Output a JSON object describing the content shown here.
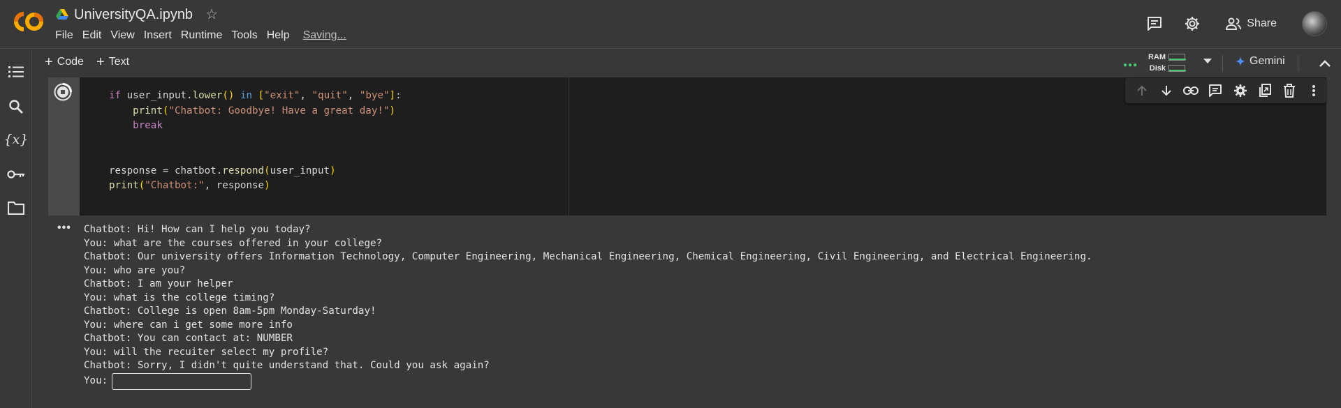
{
  "header": {
    "title": "UniversityQA.ipynb",
    "menu": [
      "File",
      "Edit",
      "View",
      "Insert",
      "Runtime",
      "Tools",
      "Help"
    ],
    "save_status": "Saving...",
    "share_label": "Share",
    "brand_colors": {
      "logo_orange": "#f9ab00",
      "logo_dark": "#e8710a"
    }
  },
  "toolbar": {
    "add_code": "Code",
    "add_text": "Text",
    "ram_label": "RAM",
    "disk_label": "Disk",
    "gemini_label": "Gemini",
    "status_color": "#48c774"
  },
  "sidebar": {
    "items": [
      "table-of-contents-icon",
      "search-icon",
      "variables-icon",
      "secrets-key-icon",
      "files-folder-icon"
    ]
  },
  "cell": {
    "code_lines": [
      "if user_input.lower() in [\"exit\", \"quit\", \"bye\"]:",
      "    print(\"Chatbot: Goodbye! Have a great day!\")",
      "    break",
      "",
      "",
      "response = chatbot.respond(user_input)",
      "print(\"Chatbot:\", response)"
    ],
    "toolbar_icons": [
      "move-up-icon",
      "move-down-icon",
      "link-icon",
      "comment-icon",
      "settings-icon",
      "mirror-cell-icon",
      "delete-icon",
      "more-icon"
    ]
  },
  "output": {
    "lines": [
      "Chatbot: Hi! How can I help you today?",
      "You: what are the courses offered in your college?",
      "Chatbot: Our university offers Information Technology, Computer Engineering, Mechanical Engineering, Chemical Engineering, Civil Engineering, and Electrical Engineering.",
      "You: who are you?",
      "Chatbot: I am your helper",
      "You: what is the college timing?",
      "Chatbot: College is open 8am-5pm Monday-Saturday!",
      "You: where can i get some more info",
      "Chatbot: You can contact at: NUMBER",
      "You: will the recuiter select my profile?",
      "Chatbot: Sorry, I didn't quite understand that. Could you ask again?"
    ],
    "prompt": "You:",
    "input_value": ""
  }
}
